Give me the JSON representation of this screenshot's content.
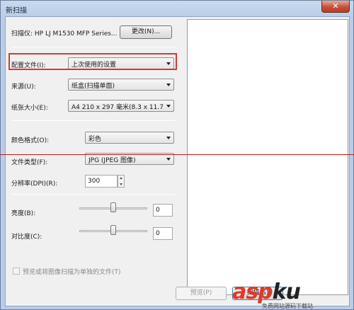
{
  "window": {
    "title": "新扫描",
    "close_glyph": "✕"
  },
  "scanner": {
    "label": "扫描仪: HP LJ M1530 MFP Series...",
    "change_button": "更改(N)..."
  },
  "profile": {
    "label": "配置文件(I):",
    "value": "上次使用的设置"
  },
  "source": {
    "label": "来源(U):",
    "value": "纸盒(扫描单面)"
  },
  "paper_size": {
    "label": "纸张大小(E):",
    "value": "A4 210 x 297 毫米(8.3 x 11.7 英"
  },
  "color_format": {
    "label": "颜色格式(O):",
    "value": "彩色"
  },
  "file_type": {
    "label": "文件类型(F):",
    "value": "JPG (JPEG 图像)"
  },
  "resolution": {
    "label": "分辨率(DPI)(R):",
    "value": "300"
  },
  "brightness": {
    "label": "亮度(B):",
    "value": "0",
    "level": 0.5
  },
  "contrast": {
    "label": "对比度(C):",
    "value": "0",
    "level": 0.5
  },
  "separate_files": {
    "label": "预览或将图像扫描为单独的文件(T)",
    "checked": false
  },
  "actions": {
    "preview_button": "预览(P)",
    "scan_button": "扫描(S)"
  },
  "watermark": {
    "brand_a": "asp",
    "brand_b": "ku",
    "tagline": "免费网站源码下载站"
  },
  "colors": {
    "highlight": "#d23a3a",
    "watermark": "#e2382a"
  }
}
